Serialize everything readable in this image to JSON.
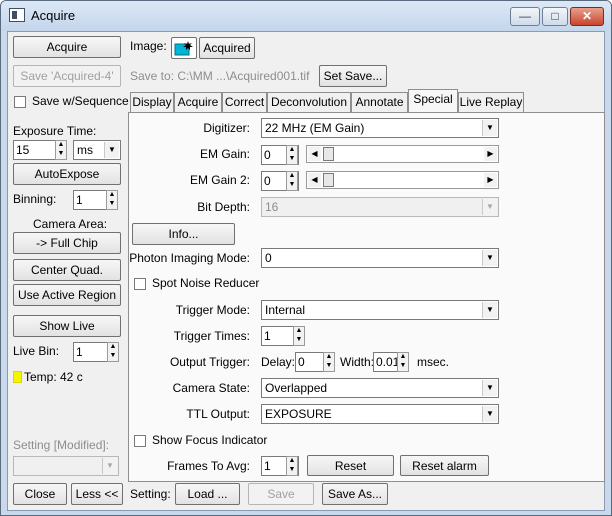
{
  "window": {
    "title": "Acquire",
    "controls": {
      "minimize": "—",
      "maximize": "□",
      "close": "✕"
    }
  },
  "left": {
    "acquire_label": "Acquire",
    "save_label": "Save 'Acquired-4'",
    "save_seq_label": "Save w/Sequence",
    "exposure_label": "Exposure Time:",
    "exposure_value": "15",
    "exposure_unit": "ms",
    "autoexpose_label": "AutoExpose",
    "binning_label": "Binning:",
    "binning_value": "1",
    "camera_area_label": "Camera Area:",
    "full_chip_label": "-> Full Chip",
    "center_quad_label": "Center Quad.",
    "active_region_label": "Use Active Region",
    "show_live_label": "Show Live",
    "live_bin_label": "Live Bin:",
    "live_bin_value": "1",
    "temp_text": "Temp: 42 c",
    "temp_color": "#f5f500",
    "setting_label": "Setting [Modified]:",
    "setting_value": ""
  },
  "image_row": {
    "image_label": "Image:",
    "acquired_label": "Acquired",
    "save_to": "Save to: C:\\MM ...\\Acquired001.tif",
    "set_save_label": "Set Save..."
  },
  "tabs": [
    "Display",
    "Acquire",
    "Correct",
    "Deconvolution",
    "Annotate",
    "Special",
    "Live Replay"
  ],
  "active_tab": "Special",
  "special": {
    "digitizer_label": "Digitizer:",
    "digitizer_value": "22 MHz (EM Gain)",
    "em_gain_label": "EM Gain:",
    "em_gain_value": "0",
    "em_gain2_label": "EM Gain 2:",
    "em_gain2_value": "0",
    "bit_depth_label": "Bit Depth:",
    "bit_depth_value": "16",
    "info_label": "Info...",
    "photon_label": "Photon Imaging Mode:",
    "photon_value": "0",
    "spot_noise_label": "Spot Noise Reducer",
    "trigger_mode_label": "Trigger Mode:",
    "trigger_mode_value": "Internal",
    "trigger_times_label": "Trigger Times:",
    "trigger_times_value": "1",
    "output_trigger_label": "Output Trigger:",
    "delay_label": "Delay:",
    "delay_value": "0",
    "width_label": "Width:",
    "width_value": "0.01",
    "msec_label": "msec.",
    "camera_state_label": "Camera State:",
    "camera_state_value": "Overlapped",
    "ttl_label": "TTL Output:",
    "ttl_value": "EXPOSURE",
    "show_focus_label": "Show Focus Indicator",
    "frames_label": "Frames To Avg:",
    "frames_value": "1",
    "reset_label": "Reset",
    "reset_alarm_label": "Reset alarm"
  },
  "bottom": {
    "close_label": "Close",
    "less_label": "Less <<",
    "setting_label": "Setting:",
    "load_label": "Load ...",
    "save_label": "Save",
    "save_as_label": "Save As..."
  }
}
